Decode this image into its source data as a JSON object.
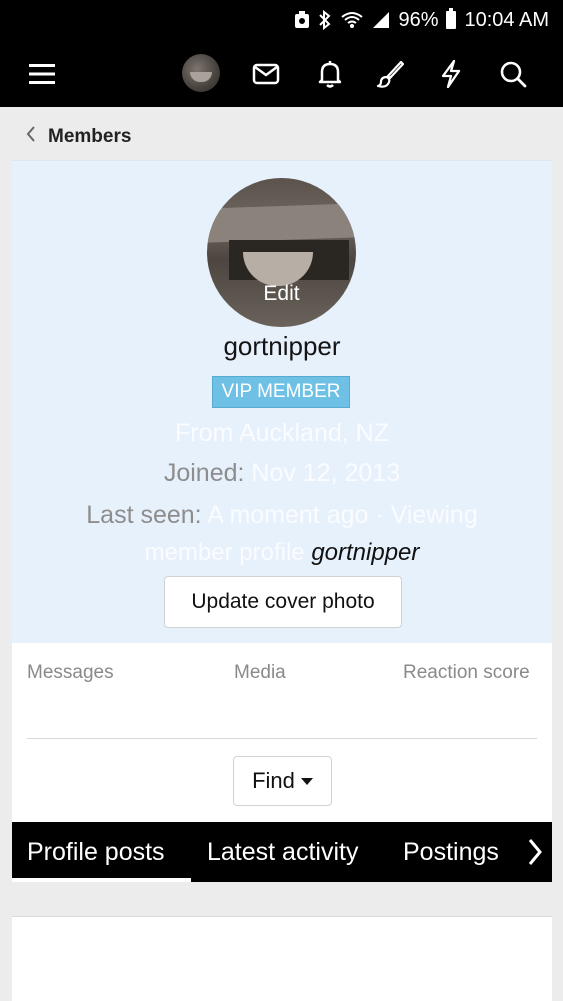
{
  "status_bar": {
    "battery": "96%",
    "time": "10:04 AM"
  },
  "navbar": {
    "icons": [
      "menu-icon",
      "avatar",
      "mail-icon",
      "bell-icon",
      "brush-icon",
      "lightning-icon",
      "search-icon"
    ]
  },
  "breadcrumb": {
    "label": "Members"
  },
  "profile": {
    "avatar_edit_label": "Edit",
    "username": "gortnipper",
    "badge": "VIP MEMBER",
    "location": "From Auckland, NZ",
    "joined_label": "Joined:",
    "joined_value": "Nov 12, 2013",
    "last_seen_label": "Last seen:",
    "last_seen_value": "A moment ago · Viewing",
    "last_seen_value_2": "member profile",
    "last_seen_user": "gortnipper",
    "cover_button": "Update cover photo"
  },
  "stats": {
    "messages": "Messages",
    "media": "Media",
    "reaction_score": "Reaction score",
    "find_button": "Find"
  },
  "tabs": [
    {
      "label": "Profile posts",
      "active": true
    },
    {
      "label": "Latest activity",
      "active": false
    },
    {
      "label": "Postings",
      "active": false
    }
  ],
  "colors": {
    "navbar_bg": "#000000",
    "profile_bg": "#e7f1fb",
    "badge_bg": "#6ec0e4"
  }
}
